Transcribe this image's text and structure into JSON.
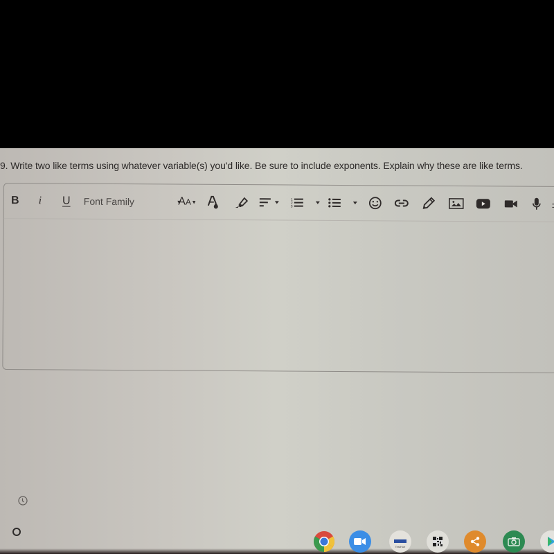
{
  "question": {
    "text": "9. Write two like terms using whatever variable(s) you'd like. Be sure to include exponents. Explain why these are like terms."
  },
  "editor": {
    "content": "",
    "toolbar": {
      "bold": "B",
      "italic": "i",
      "underline": "U",
      "font_family_label": "Font Family",
      "font_size_big": "A",
      "font_size_small": "A",
      "caret": "▾",
      "more": "±",
      "icons": [
        "bold-icon",
        "italic-icon",
        "underline-icon",
        "font-family-dropdown",
        "font-size-icon",
        "text-color-icon",
        "highlight-icon",
        "align-icon",
        "numbered-list-icon",
        "bulleted-list-icon",
        "emoji-icon",
        "link-icon",
        "pencil-icon",
        "image-icon",
        "youtube-icon",
        "video-camera-icon",
        "microphone-icon",
        "more-icon"
      ]
    }
  },
  "shelf": {
    "apps": [
      {
        "name": "chrome",
        "icon": "chrome-icon"
      },
      {
        "name": "zoom",
        "icon": "zoom-video-icon",
        "color": "#3b8ee6"
      },
      {
        "name": "fluency",
        "icon": "fluency-tutor-icon",
        "label_top": "Fluency",
        "label_bottom": "TestHue"
      },
      {
        "name": "qr-scanner",
        "icon": "qr-code-icon"
      },
      {
        "name": "share",
        "icon": "share-icon",
        "color": "#df8a2c"
      },
      {
        "name": "camera",
        "icon": "camera-icon",
        "color": "#2d8a52"
      },
      {
        "name": "play-store",
        "icon": "play-store-icon"
      }
    ]
  },
  "colors": {
    "text": "#2d2a29",
    "screen_bg": "#c9c6c0",
    "zoom_blue": "#3b8ee6",
    "share_orange": "#df8a2c",
    "camera_green": "#2d8a52"
  }
}
